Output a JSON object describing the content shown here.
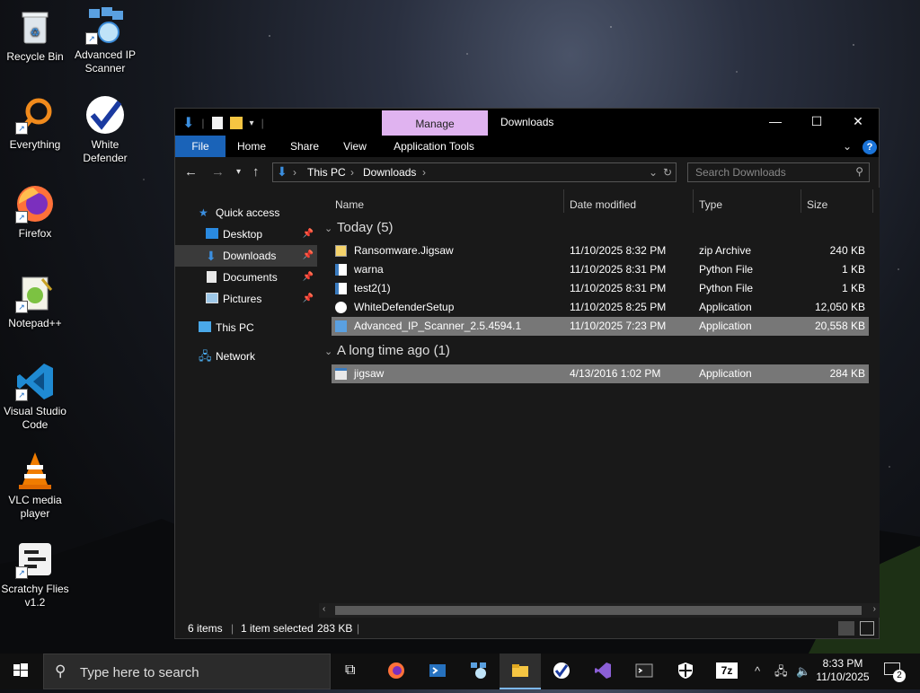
{
  "desktop": {
    "icons": [
      {
        "label": "Recycle Bin",
        "icon": "recycle-bin-icon"
      },
      {
        "label": "Advanced IP Scanner",
        "icon": "network-scanner-icon"
      },
      {
        "label": "Everything",
        "icon": "magnifier-icon"
      },
      {
        "label": "White Defender",
        "icon": "checkmark-shield-icon"
      },
      {
        "label": "Firefox",
        "icon": "firefox-icon"
      },
      {
        "label": "Notepad++",
        "icon": "notepad-icon"
      },
      {
        "label": "Visual Studio Code",
        "icon": "vscode-icon"
      },
      {
        "label": "VLC media player",
        "icon": "vlc-cone-icon"
      },
      {
        "label": "Scratchy Flies v1.2",
        "icon": "scratchy-icon"
      }
    ]
  },
  "window": {
    "title": "Downloads",
    "manage_tab": "Manage",
    "controls": {
      "minimize": "—",
      "maximize": "☐",
      "close": "✕"
    },
    "ribbon_tabs": [
      "File",
      "Home",
      "Share",
      "View",
      "Application Tools"
    ],
    "address": {
      "crumbs": [
        "This PC",
        "Downloads"
      ],
      "search_placeholder": "Search Downloads"
    },
    "nav_pane": {
      "quick_access": "Quick access",
      "items": [
        {
          "label": "Desktop",
          "pinned": true
        },
        {
          "label": "Downloads",
          "pinned": true
        },
        {
          "label": "Documents",
          "pinned": true
        },
        {
          "label": "Pictures",
          "pinned": true
        }
      ],
      "this_pc": "This PC",
      "network": "Network"
    },
    "columns": {
      "name": "Name",
      "date": "Date modified",
      "type": "Type",
      "size": "Size"
    },
    "groups": [
      {
        "title": "Today (5)",
        "files": [
          {
            "name": "Ransomware.Jigsaw",
            "date": "11/10/2025 8:32 PM",
            "type": "zip Archive",
            "size": "240 KB",
            "icon": "zip-archive-icon",
            "selected": false
          },
          {
            "name": "warna",
            "date": "11/10/2025 8:31 PM",
            "type": "Python File",
            "size": "1 KB",
            "icon": "python-file-icon",
            "selected": false
          },
          {
            "name": "test2(1)",
            "date": "11/10/2025 8:31 PM",
            "type": "Python File",
            "size": "1 KB",
            "icon": "python-file-icon",
            "selected": false
          },
          {
            "name": "WhiteDefenderSetup",
            "date": "11/10/2025 8:25 PM",
            "type": "Application",
            "size": "12,050 KB",
            "icon": "checkmark-shield-icon",
            "selected": false
          },
          {
            "name": "Advanced_IP_Scanner_2.5.4594.1",
            "date": "11/10/2025 7:23 PM",
            "type": "Application",
            "size": "20,558 KB",
            "icon": "network-scanner-icon",
            "selected": true
          }
        ]
      },
      {
        "title": "A long time ago (1)",
        "files": [
          {
            "name": "jigsaw",
            "date": "4/13/2016 1:02 PM",
            "type": "Application",
            "size": "284 KB",
            "icon": "application-icon",
            "selected": true
          }
        ]
      }
    ],
    "status": {
      "items": "6 items",
      "selected": "1 item selected",
      "size": "283 KB"
    }
  },
  "taskbar": {
    "search_placeholder": "Type here to search",
    "apps": [
      "task-view-icon",
      "firefox-icon",
      "powershell-icon",
      "network-scanner-icon",
      "file-explorer-icon",
      "checkmark-shield-icon",
      "visual-studio-icon",
      "terminal-icon",
      "security-shield-icon",
      "7zip-icon"
    ],
    "clock": {
      "time": "8:33 PM",
      "date": "11/10/2025"
    },
    "notifications": "2"
  }
}
